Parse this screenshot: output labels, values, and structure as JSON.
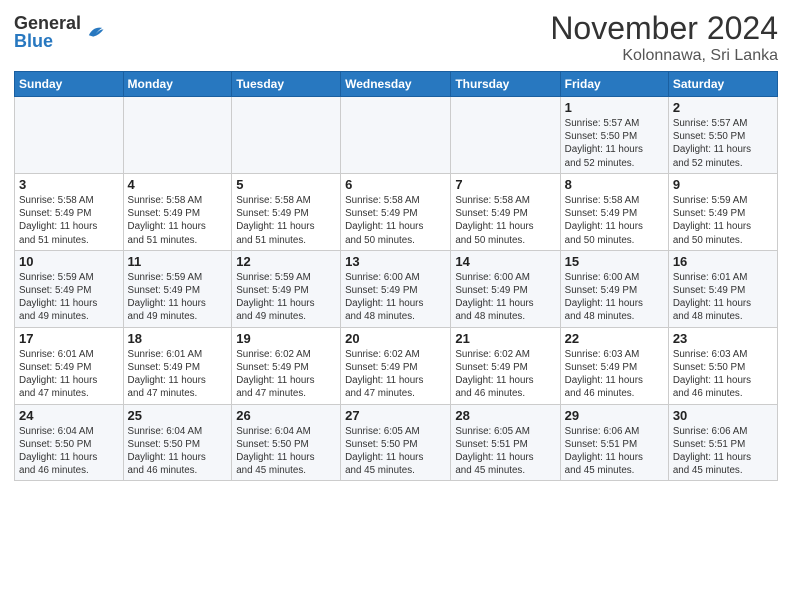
{
  "header": {
    "logo": {
      "general": "General",
      "blue": "Blue"
    },
    "title": "November 2024",
    "subtitle": "Kolonnawa, Sri Lanka"
  },
  "weekdays": [
    "Sunday",
    "Monday",
    "Tuesday",
    "Wednesday",
    "Thursday",
    "Friday",
    "Saturday"
  ],
  "weeks": [
    [
      {
        "day": null,
        "info": null
      },
      {
        "day": null,
        "info": null
      },
      {
        "day": null,
        "info": null
      },
      {
        "day": null,
        "info": null
      },
      {
        "day": null,
        "info": null
      },
      {
        "day": "1",
        "info": "Sunrise: 5:57 AM\nSunset: 5:50 PM\nDaylight: 11 hours\nand 52 minutes."
      },
      {
        "day": "2",
        "info": "Sunrise: 5:57 AM\nSunset: 5:50 PM\nDaylight: 11 hours\nand 52 minutes."
      }
    ],
    [
      {
        "day": "3",
        "info": "Sunrise: 5:58 AM\nSunset: 5:49 PM\nDaylight: 11 hours\nand 51 minutes."
      },
      {
        "day": "4",
        "info": "Sunrise: 5:58 AM\nSunset: 5:49 PM\nDaylight: 11 hours\nand 51 minutes."
      },
      {
        "day": "5",
        "info": "Sunrise: 5:58 AM\nSunset: 5:49 PM\nDaylight: 11 hours\nand 51 minutes."
      },
      {
        "day": "6",
        "info": "Sunrise: 5:58 AM\nSunset: 5:49 PM\nDaylight: 11 hours\nand 50 minutes."
      },
      {
        "day": "7",
        "info": "Sunrise: 5:58 AM\nSunset: 5:49 PM\nDaylight: 11 hours\nand 50 minutes."
      },
      {
        "day": "8",
        "info": "Sunrise: 5:58 AM\nSunset: 5:49 PM\nDaylight: 11 hours\nand 50 minutes."
      },
      {
        "day": "9",
        "info": "Sunrise: 5:59 AM\nSunset: 5:49 PM\nDaylight: 11 hours\nand 50 minutes."
      }
    ],
    [
      {
        "day": "10",
        "info": "Sunrise: 5:59 AM\nSunset: 5:49 PM\nDaylight: 11 hours\nand 49 minutes."
      },
      {
        "day": "11",
        "info": "Sunrise: 5:59 AM\nSunset: 5:49 PM\nDaylight: 11 hours\nand 49 minutes."
      },
      {
        "day": "12",
        "info": "Sunrise: 5:59 AM\nSunset: 5:49 PM\nDaylight: 11 hours\nand 49 minutes."
      },
      {
        "day": "13",
        "info": "Sunrise: 6:00 AM\nSunset: 5:49 PM\nDaylight: 11 hours\nand 48 minutes."
      },
      {
        "day": "14",
        "info": "Sunrise: 6:00 AM\nSunset: 5:49 PM\nDaylight: 11 hours\nand 48 minutes."
      },
      {
        "day": "15",
        "info": "Sunrise: 6:00 AM\nSunset: 5:49 PM\nDaylight: 11 hours\nand 48 minutes."
      },
      {
        "day": "16",
        "info": "Sunrise: 6:01 AM\nSunset: 5:49 PM\nDaylight: 11 hours\nand 48 minutes."
      }
    ],
    [
      {
        "day": "17",
        "info": "Sunrise: 6:01 AM\nSunset: 5:49 PM\nDaylight: 11 hours\nand 47 minutes."
      },
      {
        "day": "18",
        "info": "Sunrise: 6:01 AM\nSunset: 5:49 PM\nDaylight: 11 hours\nand 47 minutes."
      },
      {
        "day": "19",
        "info": "Sunrise: 6:02 AM\nSunset: 5:49 PM\nDaylight: 11 hours\nand 47 minutes."
      },
      {
        "day": "20",
        "info": "Sunrise: 6:02 AM\nSunset: 5:49 PM\nDaylight: 11 hours\nand 47 minutes."
      },
      {
        "day": "21",
        "info": "Sunrise: 6:02 AM\nSunset: 5:49 PM\nDaylight: 11 hours\nand 46 minutes."
      },
      {
        "day": "22",
        "info": "Sunrise: 6:03 AM\nSunset: 5:49 PM\nDaylight: 11 hours\nand 46 minutes."
      },
      {
        "day": "23",
        "info": "Sunrise: 6:03 AM\nSunset: 5:50 PM\nDaylight: 11 hours\nand 46 minutes."
      }
    ],
    [
      {
        "day": "24",
        "info": "Sunrise: 6:04 AM\nSunset: 5:50 PM\nDaylight: 11 hours\nand 46 minutes."
      },
      {
        "day": "25",
        "info": "Sunrise: 6:04 AM\nSunset: 5:50 PM\nDaylight: 11 hours\nand 46 minutes."
      },
      {
        "day": "26",
        "info": "Sunrise: 6:04 AM\nSunset: 5:50 PM\nDaylight: 11 hours\nand 45 minutes."
      },
      {
        "day": "27",
        "info": "Sunrise: 6:05 AM\nSunset: 5:50 PM\nDaylight: 11 hours\nand 45 minutes."
      },
      {
        "day": "28",
        "info": "Sunrise: 6:05 AM\nSunset: 5:51 PM\nDaylight: 11 hours\nand 45 minutes."
      },
      {
        "day": "29",
        "info": "Sunrise: 6:06 AM\nSunset: 5:51 PM\nDaylight: 11 hours\nand 45 minutes."
      },
      {
        "day": "30",
        "info": "Sunrise: 6:06 AM\nSunset: 5:51 PM\nDaylight: 11 hours\nand 45 minutes."
      }
    ]
  ]
}
